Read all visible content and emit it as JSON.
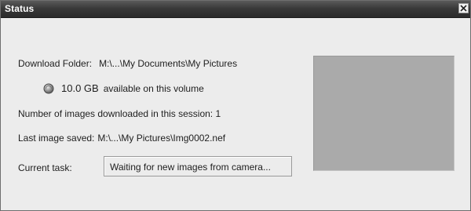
{
  "window": {
    "title": "Status",
    "close_icon": "close-icon"
  },
  "download_folder": {
    "label": "Download Folder:",
    "value": "M:\\...\\My Documents\\My Pictures"
  },
  "free_space": {
    "icon": "disk-icon",
    "amount": "10.0 GB",
    "suffix": "available on this volume"
  },
  "images_count": {
    "text": "Number of images downloaded in this session:",
    "value": "1"
  },
  "last_image": {
    "label": "Last image saved:",
    "value": "M:\\...\\My Pictures\\Img0002.nef"
  },
  "current_task": {
    "label": "Current task:",
    "value": "Waiting for new images from camera..."
  },
  "colors": {
    "titlebar": "#3a3a3a",
    "window_bg": "#ececec",
    "preview_bg": "#aaaaaa"
  }
}
